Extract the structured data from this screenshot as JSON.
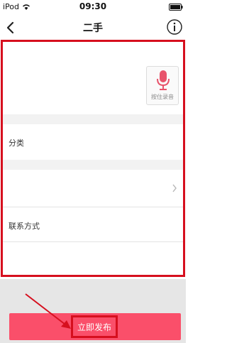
{
  "status_bar": {
    "carrier": "iPod",
    "time": "09:30"
  },
  "nav": {
    "title": "二手",
    "back_icon": "chevron-left-icon",
    "info_icon": "info-icon"
  },
  "form": {
    "voice_button_label": "按住录音",
    "voice_icon": "microphone-icon",
    "category_label": "分类",
    "contact_label": "联系方式"
  },
  "footer": {
    "publish_label": "立即发布"
  },
  "colors": {
    "accent": "#fa4f6a",
    "annotation": "#d60f1e",
    "mic": "#e8536b"
  }
}
